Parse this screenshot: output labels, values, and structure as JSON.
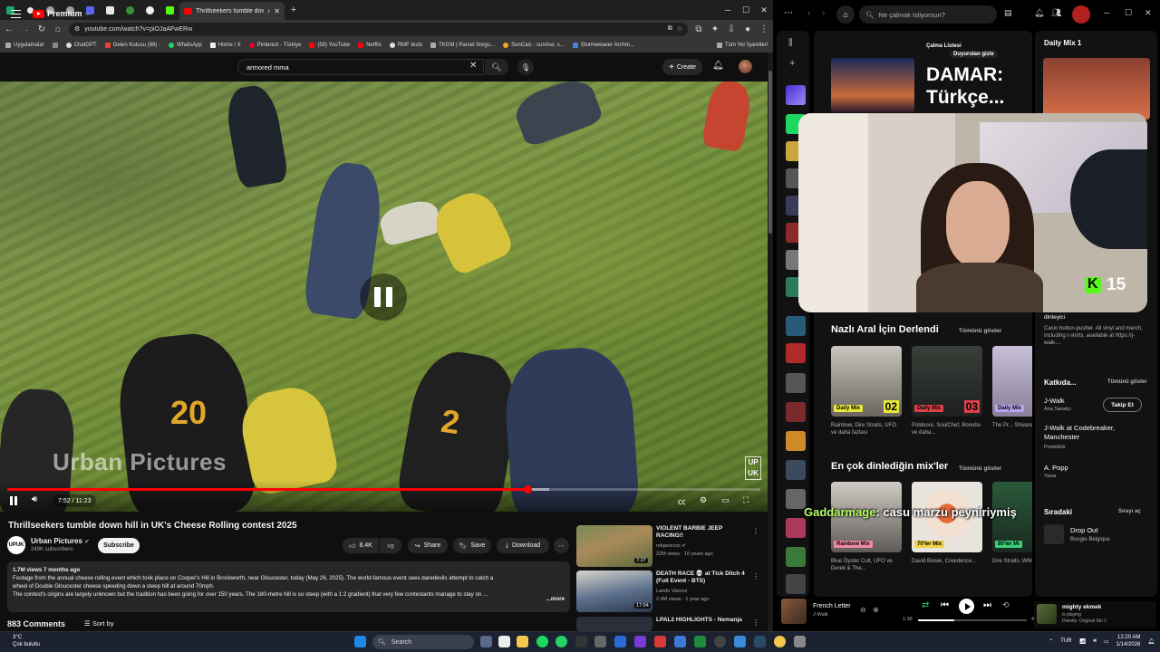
{
  "chrome": {
    "active_tab_title": "Thrillseekers tumble down",
    "url": "youtube.com/watch?v=piOJaAFwERw",
    "bookmarks": [
      "Uygulamalar",
      "ChatGPT",
      "Gelen Kutusu (98) -",
      "WhatsApp",
      "Home / X",
      "Pinterest - Türkiye",
      "(58) YouTube",
      "Netflix",
      "RMF tests",
      "TKGM | Parsel Sorgu...",
      "SunCalc - sunrise, s...",
      "Stormweaver Archm..."
    ],
    "all_bookmarks": "Tüm Yer İşaretleri"
  },
  "youtube": {
    "logo": "Premium",
    "logo_suffix": "TR",
    "search_query": "armored mma",
    "create_label": "Create",
    "video": {
      "watermark": "Urban Pictures",
      "uk_mark_top": "UP",
      "uk_mark_bottom": "UK",
      "time": "7:52 / 11:23",
      "progress": 0.691,
      "buffered": 0.72
    },
    "title": "Thrillseekers tumble down hill in UK's Cheese Rolling contest 2025",
    "channel": {
      "name": "Urban Pictures",
      "subs": "249K subscribers",
      "avatar_top": "UP",
      "avatar_bottom": "UK"
    },
    "subscribe_label": "Subscribe",
    "likes": "8.4K",
    "share_label": "Share",
    "save_label": "Save",
    "download_label": "Download",
    "description": {
      "meta": "1.7M views  7 months ago",
      "line1": "Footage from the annual cheese rolling event which took place on Cooper's Hill in Brockworth, near Gloucester, today (May 26, 2025). The world-famous event sees daredevils attempt to catch a",
      "line2": "wheel of Double Gloucester cheese speeding down a steep hill at around 70mph.",
      "line3": "The contest's origins are largely unknown but the tradition has been going for over 150 years. The 180-metre hill is so steep (with a 1:2 gradient) that very few contestants manage to stay on ...",
      "more": "...more"
    },
    "comments_count": "883 Comments",
    "sort_label": "Sort by",
    "recs": [
      {
        "title": "VIOLENT BARBIE JEEP RACING!!",
        "channel": "rekjavicxxx",
        "meta": "22M views · 10 years ago",
        "duration": "7:27"
      },
      {
        "title": "DEATH RACE 💀 at Tick Ditch 4 (Full Event - BTS)",
        "channel": "Lando Visionz",
        "meta": "2.4M views · 1 year ago",
        "duration": "17:04"
      },
      {
        "title": "LPAL2 HIGHLIGHTS - Nemanja",
        "channel": "",
        "meta": "",
        "duration": ""
      }
    ]
  },
  "spotify": {
    "search_placeholder": "Ne çalmak istiyorsun?",
    "featured_title": "DAMAR: Türkçe...",
    "featured_small": "Çalma Listesi",
    "featured_sub": "Duyurulan gizle",
    "daily_mix_header": "Daily Mix 1",
    "section1": "Nazlı Aral İçin Derlendi",
    "section2": "En çok dinlediğin mix'ler",
    "show_all": "Tümünü göster",
    "mixes1": [
      {
        "tag": "Daily Mix",
        "num": "02",
        "caption": "Rainbow, Dire Straits, UFO ve daha fazlası"
      },
      {
        "tag": "Daily Mix",
        "num": "03",
        "caption": "Poldoore, SoulChef, Bonobo ve daha..."
      },
      {
        "tag": "Daily Mix",
        "num": "",
        "caption": "The Pr... Shivaree"
      }
    ],
    "mixes2": [
      {
        "tag": "Rainbow Mix",
        "caption": "Blue Öyster Cult, UFO ve Derek & The..."
      },
      {
        "tag": "70'ler Mix",
        "caption": "David Bowie, Creedence..."
      },
      {
        "tag": "80'ler Mi",
        "caption": "Dire Straits, Whitesnake"
      }
    ],
    "right": {
      "listener_label": "dinleyici",
      "bio": "Casio button-pusher. All vinyl and merch, including t-shirts, available at https://j-walk-...",
      "credits_title": "Katkıda...",
      "credits_show_all": "Tümünü göster",
      "artist": "J-Walk",
      "artist_role": "Ana Sanatçı",
      "follow": "Takip Et",
      "artist2": "J-Walk at Codebreaker, Manchester",
      "artist2_role": "Prodüktör",
      "artist3": "A. Popp",
      "artist3_role": "Yazar",
      "queue_title": "Sıradaki",
      "queue_open": "Sırayı aç",
      "queue_track": "Drop Out",
      "queue_artist": "Boogie Belgique"
    },
    "player": {
      "track": "French Letter",
      "artist": "J-Walk",
      "elapsed": "1:36",
      "total": "4:53",
      "progress": 0.33
    },
    "kick_count": "15",
    "chat_user": "Gaddarmage",
    "chat_text": ": casu marzu peyniriymiş",
    "notification_title": "mighty ekmek",
    "notification_sub": "is playing",
    "notification_game": "Divinity: Original Sin 2"
  },
  "taskbar": {
    "weather_temp": "3°C",
    "weather_desc": "Çok bulutlu",
    "search": "Search",
    "lang": "TUR",
    "time": "12:20 AM",
    "date": "1/14/2026"
  }
}
